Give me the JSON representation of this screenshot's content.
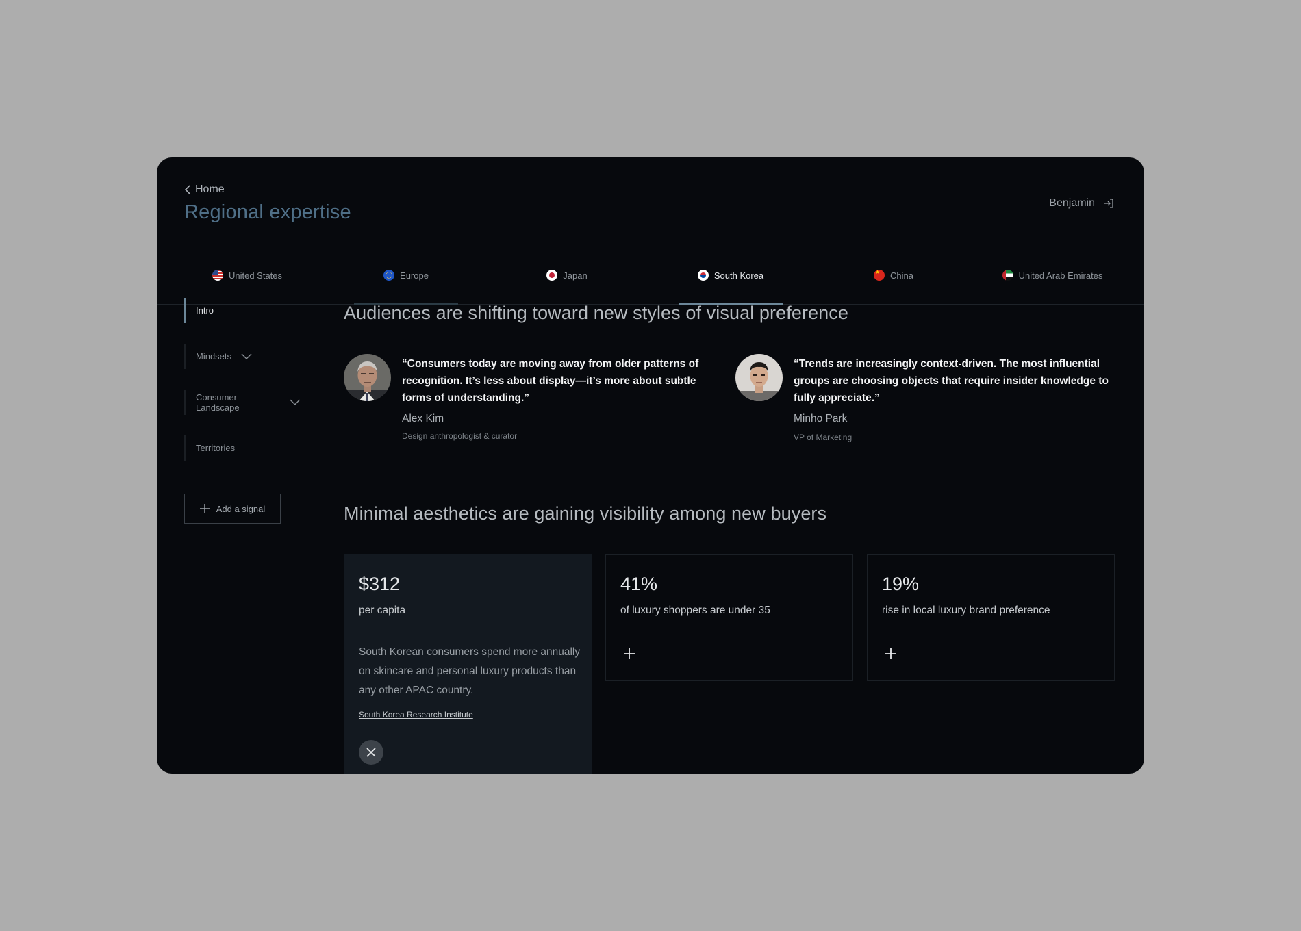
{
  "header": {
    "back_label": "Home",
    "title": "Regional expertise",
    "user_name": "Benjamin"
  },
  "tabs": [
    {
      "label": "United States",
      "flag": "us-flag-icon"
    },
    {
      "label": "Europe",
      "flag": "eu-flag-icon"
    },
    {
      "label": "Japan",
      "flag": "japan-flag-icon"
    },
    {
      "label": "South Korea",
      "flag": "south-korea-flag-icon",
      "active": true
    },
    {
      "label": "China",
      "flag": "china-flag-icon"
    },
    {
      "label": "United Arab Emirates",
      "flag": "uae-flag-icon"
    }
  ],
  "sidebar": {
    "items": [
      {
        "label": "Intro",
        "active": true
      },
      {
        "label": "Mindsets",
        "expandable": true
      },
      {
        "label": "Consumer Landscape",
        "expandable": true
      },
      {
        "label": "Territories"
      }
    ],
    "add_signal_label": "Add a signal"
  },
  "section1": {
    "heading": "Audiences are shifting toward new styles of visual preference",
    "quotes": [
      {
        "text": "“Consumers today are moving away from older patterns of recognition. It’s less about display—it’s more about subtle forms of understanding.”",
        "name": "Alex Kim",
        "role": "Design anthropologist & curator"
      },
      {
        "text": "“Trends are increasingly context-driven. The most influential groups are choosing objects that require insider knowledge to fully appreciate.”",
        "name": "Minho Park",
        "role": "VP of Marketing"
      }
    ]
  },
  "section2": {
    "heading": "Minimal aesthetics are gaining visibility among new buyers",
    "cards": [
      {
        "stat": "$312",
        "label": "per capita",
        "description": "South Korean consumers spend more annually on skincare and personal luxury products than any other APAC country.",
        "source": "South Korea Research Institute",
        "expanded": true
      },
      {
        "stat": "41%",
        "label": "of luxury shoppers are under 35",
        "expanded": false
      },
      {
        "stat": "19%",
        "label": "rise in local luxury brand preference",
        "expanded": false
      }
    ]
  },
  "colors": {
    "page_bg": "#adadad",
    "panel_bg": "#07090d",
    "accent": "#6c8799",
    "title": "#4f6f87",
    "card_open_bg": "#131920"
  }
}
